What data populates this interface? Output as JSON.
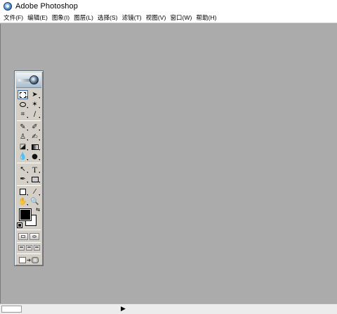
{
  "window": {
    "title": "Adobe Photoshop",
    "icon": "photoshop-eye-icon"
  },
  "menubar": {
    "items": [
      {
        "label": "文件(F)"
      },
      {
        "label": "编辑(E)"
      },
      {
        "label": "图象(I)"
      },
      {
        "label": "图层(L)"
      },
      {
        "label": "选择(S)"
      },
      {
        "label": "滤镜(T)"
      },
      {
        "label": "视图(V)"
      },
      {
        "label": "窗口(W)"
      },
      {
        "label": "帮助(H)"
      }
    ]
  },
  "toolbox": {
    "tools": [
      {
        "name": "rectangular-marquee-tool",
        "icon": "marquee-icon",
        "selected": true
      },
      {
        "name": "move-tool",
        "icon": "move-arrow-icon"
      },
      {
        "name": "lasso-tool",
        "icon": "lasso-icon"
      },
      {
        "name": "magic-wand-tool",
        "icon": "magic-wand-icon"
      },
      {
        "name": "crop-tool",
        "icon": "crop-icon"
      },
      {
        "name": "slice-tool",
        "icon": "slice-icon"
      },
      {
        "name": "healing-brush-tool",
        "icon": "bandage-icon"
      },
      {
        "name": "brush-tool",
        "icon": "brush-icon"
      },
      {
        "name": "clone-stamp-tool",
        "icon": "stamp-icon"
      },
      {
        "name": "history-brush-tool",
        "icon": "history-brush-icon"
      },
      {
        "name": "eraser-tool",
        "icon": "eraser-icon"
      },
      {
        "name": "gradient-tool",
        "icon": "gradient-icon"
      },
      {
        "name": "blur-tool",
        "icon": "drop-icon"
      },
      {
        "name": "dodge-tool",
        "icon": "dodge-icon"
      },
      {
        "name": "path-selection-tool",
        "icon": "arrow-icon"
      },
      {
        "name": "type-tool",
        "icon": "type-icon",
        "glyph": "T"
      },
      {
        "name": "pen-tool",
        "icon": "pen-icon"
      },
      {
        "name": "rectangle-tool",
        "icon": "rectangle-shape-icon"
      },
      {
        "name": "notes-tool",
        "icon": "note-icon"
      },
      {
        "name": "eyedropper-tool",
        "icon": "eyedropper-icon"
      },
      {
        "name": "hand-tool",
        "icon": "hand-icon"
      },
      {
        "name": "zoom-tool",
        "icon": "magnifier-icon"
      }
    ],
    "colors": {
      "foreground": "#000000",
      "background": "#ffffff"
    }
  },
  "statusbar": {
    "arrow_icon": "triangle-right-icon"
  }
}
